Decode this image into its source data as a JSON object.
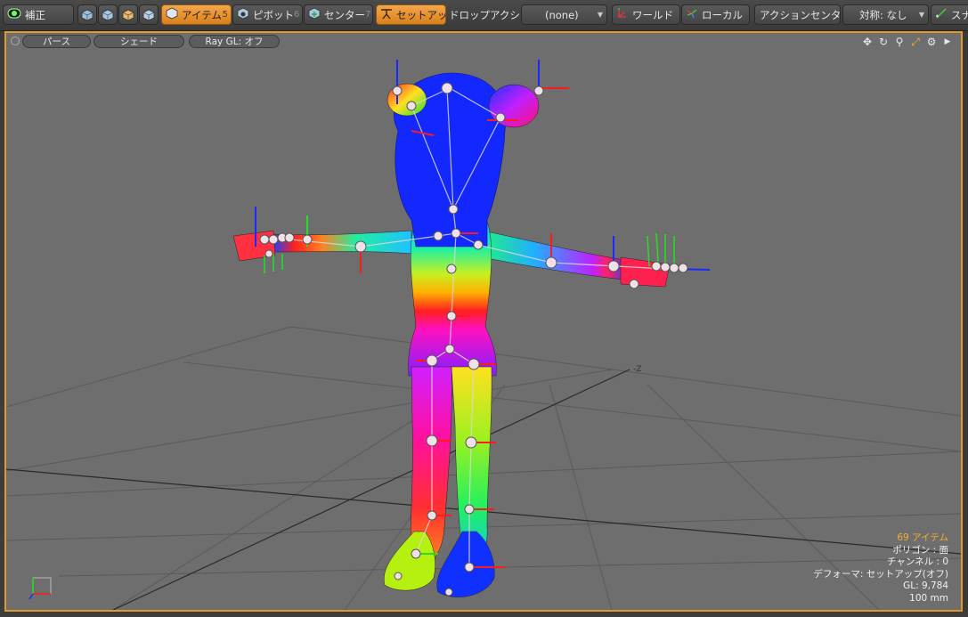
{
  "toolbar": {
    "correction_label": "補正",
    "item_label": "アイテム",
    "item_num": "5",
    "pivot_label": "ピボット",
    "pivot_num": "6",
    "center_label": "センター",
    "center_num": "7",
    "setup_label": "セットアップ",
    "drop_action_label": "ドロップアクション",
    "drop_action_value": "(none)",
    "world_label": "ワールド",
    "local_label": "ローカル",
    "action_center_label": "アクションセンター",
    "symmetry_label": "対称: なし",
    "snap_label": "スナ"
  },
  "viewport": {
    "tabs": [
      "パース",
      "シェード",
      "Ray GL: オフ"
    ],
    "axis_label": "-Z",
    "info": {
      "items": "69 アイテム",
      "polygon": "ポリゴン : 面",
      "channel": "チャンネル : 0",
      "deformer": "デフォーマ: セットアップ(オフ)",
      "gl": "GL: 9,784",
      "scale": "100 mm"
    }
  },
  "colors": {
    "accent": "#e09a2a",
    "viewport_bg": "#6e6e6e",
    "toolbar_bg": "#404040"
  }
}
